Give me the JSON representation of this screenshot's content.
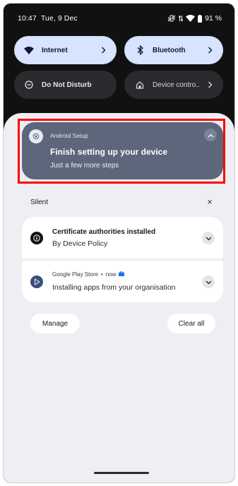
{
  "status_bar": {
    "time": "10:47",
    "date": "Tue, 9 Dec",
    "battery": "91 %",
    "icons": [
      "mute-vibrate-icon",
      "data-arrows-icon",
      "wifi-icon",
      "battery-icon"
    ]
  },
  "quick_settings": {
    "internet": {
      "label": "Internet",
      "icon": "wifi-icon",
      "state": "on"
    },
    "bluetooth": {
      "label": "Bluetooth",
      "icon": "bluetooth-icon",
      "state": "on"
    },
    "dnd": {
      "label": "Do Not Disturb",
      "icon": "do-not-disturb-icon",
      "state": "off"
    },
    "device_controls": {
      "label": "Device contro..",
      "icon": "home-icon",
      "state": "off"
    }
  },
  "setup_notification": {
    "app": "Android Setup",
    "title": "Finish setting up your device",
    "subtitle": "Just a few more steps",
    "icon": "gear-icon"
  },
  "silent_section": {
    "label": "Silent",
    "close_symbol": "×"
  },
  "notifications": [
    {
      "title": "Certificate authorities installed",
      "subtitle": "By Device Policy",
      "icon": "info-icon"
    },
    {
      "app": "Google Play Store",
      "separator": "•",
      "time": "now",
      "subtitle": "Installing apps from your organisation",
      "icon": "play-store-icon",
      "badge_icon": "work-briefcase-icon"
    }
  ],
  "actions": {
    "manage": "Manage",
    "clear_all": "Clear all"
  },
  "colors": {
    "tile_on": "#d7e3ff",
    "tile_off": "#2a2b2e",
    "setup_card": "#5d667a",
    "shade": "#efeff3",
    "highlight": "#ff0000",
    "work_badge": "#1a73e8"
  }
}
